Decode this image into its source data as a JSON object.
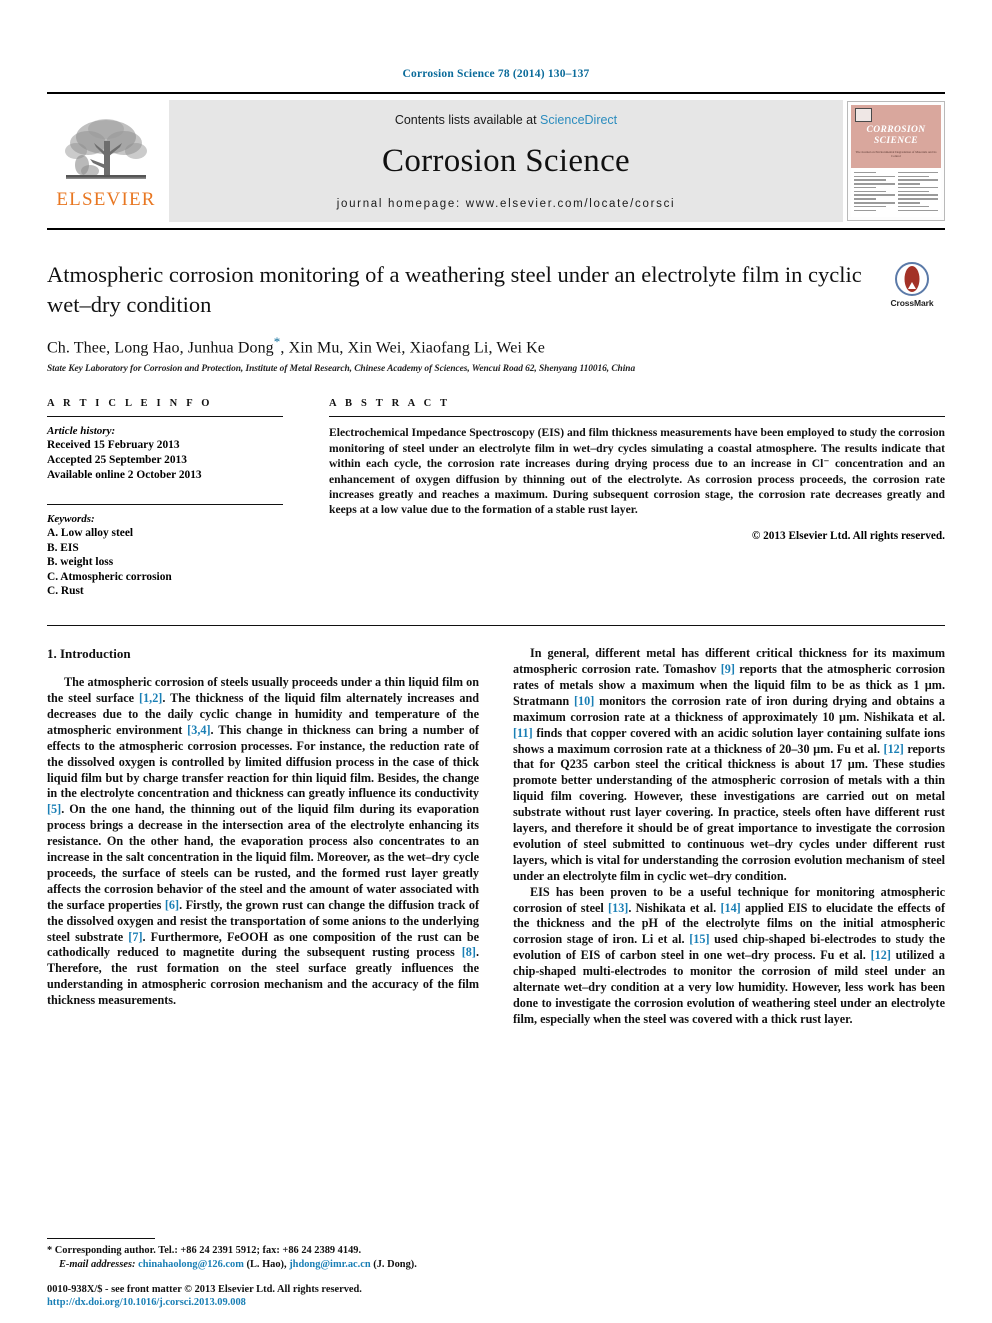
{
  "running_head": "Corrosion Science 78 (2014) 130–137",
  "masthead": {
    "publisher_name": "ELSEVIER",
    "contents_prefix": "Contents lists available at ",
    "contents_link": "ScienceDirect",
    "journal_title": "Corrosion Science",
    "homepage": "journal homepage: www.elsevier.com/locate/corsci",
    "cover_title_line1": "CORROSION",
    "cover_title_line2": "SCIENCE",
    "cover_subtitle": "The Journal on Environmental Degradation of Materials and its Control"
  },
  "article": {
    "title": "Atmospheric corrosion monitoring of a weathering steel under an electrolyte film in cyclic wet–dry condition",
    "crossmark_label": "CrossMark",
    "authors": "Ch. Thee, Long Hao, Junhua Dong",
    "authors_tail": ", Xin Mu, Xin Wei, Xiaofang Li, Wei Ke",
    "corresponding_marker": "*",
    "affiliation": "State Key Laboratory for Corrosion and Protection, Institute of Metal Research, Chinese Academy of Sciences, Wencui Road 62, Shenyang 110016, China"
  },
  "article_info": {
    "heading": "A R T I C L E    I N F O",
    "history_label": "Article history:",
    "history": [
      "Received 15 February 2013",
      "Accepted 25 September 2013",
      "Available online 2 October 2013"
    ],
    "keywords_label": "Keywords:",
    "keywords": [
      "A. Low alloy steel",
      "B. EIS",
      "B. weight loss",
      "C. Atmospheric corrosion",
      "C. Rust"
    ]
  },
  "abstract": {
    "heading": "A B S T R A C T",
    "body": "Electrochemical Impedance Spectroscopy (EIS) and film thickness measurements have been employed to study the corrosion monitoring of steel under an electrolyte film in wet–dry cycles simulating a coastal atmosphere. The results indicate that within each cycle, the corrosion rate increases during drying process due to an increase in Cl⁻ concentration and an enhancement of oxygen diffusion by thinning out of the electrolyte. As corrosion process proceeds, the corrosion rate increases greatly and reaches a maximum. During subsequent corrosion stage, the corrosion rate decreases greatly and keeps at a low value due to the formation of a stable rust layer.",
    "copyright": "© 2013 Elsevier Ltd. All rights reserved."
  },
  "body": {
    "section_heading": "1. Introduction",
    "left_para_1_a": "The atmospheric corrosion of steels usually proceeds under a thin liquid film on the steel surface ",
    "left_ref_1": "[1,2]",
    "left_para_1_b": ". The thickness of the liquid film alternately increases and decreases due to the daily cyclic change in humidity and temperature of the atmospheric environment ",
    "left_ref_2": "[3,4]",
    "left_para_1_c": ". This change in thickness can bring a number of effects to the atmospheric corrosion processes. For instance, the reduction rate of the dissolved oxygen is controlled by limited diffusion process in the case of thick liquid film but by charge transfer reaction for thin liquid film. Besides, the change in the electrolyte concentration and thickness can greatly influence its conductivity ",
    "left_ref_3": "[5]",
    "left_para_1_d": ". On the one hand, the thinning out of the liquid film during its evaporation process brings a decrease in the intersection area of the electrolyte enhancing its resistance. On the other hand, the evaporation process also concentrates to an increase in the salt concentration in the liquid film. Moreover, as the wet–dry cycle proceeds, the surface of steels can be rusted, and the formed rust layer greatly affects the corrosion behavior of the steel and the amount of water associated with the surface properties ",
    "left_ref_4": "[6]",
    "left_para_1_e": ". Firstly, the grown rust can change the diffusion track of the dissolved oxygen and resist the transportation of some anions to the underlying steel substrate ",
    "left_ref_5": "[7]",
    "left_para_1_f": ". Furthermore, FeOOH as one composition of the rust can be cathodically reduced to magnetite during the subsequent rusting process ",
    "left_ref_6": "[8]",
    "left_para_1_g": ". Therefore, the rust formation on the steel surface greatly influences the understanding in atmospheric corrosion mechanism and the accuracy of the film thickness measurements.",
    "right_para_1_a": "In general, different metal has different critical thickness for its maximum atmospheric corrosion rate. Tomashov ",
    "right_ref_1": "[9]",
    "right_para_1_b": " reports that the atmospheric corrosion rates of metals show a maximum when the liquid film to be as thick as 1 µm. Stratmann ",
    "right_ref_2": "[10]",
    "right_para_1_c": " monitors the corrosion rate of iron during drying and obtains a maximum corrosion rate at a thickness of approximately 10 µm. Nishikata et al. ",
    "right_ref_3": "[11]",
    "right_para_1_d": " finds that copper covered with an acidic solution layer containing sulfate ions shows a maximum corrosion rate at a thickness of 20–30 µm. Fu et al. ",
    "right_ref_4": "[12]",
    "right_para_1_e": " reports that for Q235 carbon steel the critical thickness is about 17 µm. These studies promote better understanding of the atmospheric corrosion of metals with a thin liquid film covering. However, these investigations are carried out on metal substrate without rust layer covering. In practice, steels often have different rust layers, and therefore it should be of great importance to investigate the corrosion evolution of steel submitted to continuous wet–dry cycles under different rust layers, which is vital for understanding the corrosion evolution mechanism of steel under an electrolyte film in cyclic wet–dry condition.",
    "right_para_2_a": "EIS has been proven to be a useful technique for monitoring atmospheric corrosion of steel ",
    "right_ref_5": "[13]",
    "right_para_2_b": ". Nishikata et al. ",
    "right_ref_6": "[14]",
    "right_para_2_c": " applied EIS to elucidate the effects of the thickness and the pH of the electrolyte films on the initial atmospheric corrosion stage of iron. Li et al. ",
    "right_ref_7": "[15]",
    "right_para_2_d": " used chip-shaped bi-electrodes to study the evolution of EIS of carbon steel in one wet–dry process. Fu et al. ",
    "right_ref_8": "[12]",
    "right_para_2_e": " utilized a chip-shaped multi-electrodes to monitor the corrosion of mild steel under an alternate wet–dry condition at a very low humidity. However, less work has been done to investigate the corrosion evolution of weathering steel under an electrolyte film, especially when the steel was covered with a thick rust layer."
  },
  "footnotes": {
    "corresponding_marker": "*",
    "corresponding_text": " Corresponding author. Tel.: +86 24 2391 5912; fax: +86 24 2389 4149.",
    "email_label": "E-mail addresses:",
    "email_1": "chinahaolong@126.com",
    "email_1_owner": " (L. Hao), ",
    "email_2": "jhdong@imr.ac.cn",
    "email_2_owner": " (J. Dong).",
    "issn_line": "0010-938X/$ - see front matter © 2013 Elsevier Ltd. All rights reserved.",
    "doi_line": "http://dx.doi.org/10.1016/j.corsci.2013.09.008"
  }
}
